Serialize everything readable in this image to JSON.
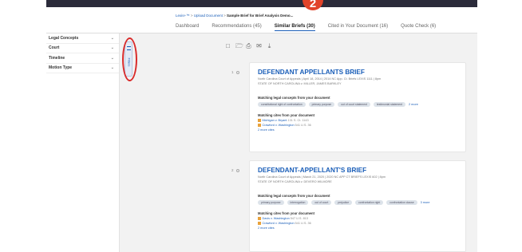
{
  "header": {
    "breadcrumb": [
      "Lexis+™",
      "Upload Document",
      "Sample Brief for Brief Analysis Demo..."
    ],
    "tabs": [
      {
        "label": "Dashboard"
      },
      {
        "label": "Recommendations (45)"
      },
      {
        "label": "Similar Briefs (30)"
      },
      {
        "label": "Cited in Your Document (16)"
      },
      {
        "label": "Quote Check (6)"
      }
    ],
    "active_tab": "Similar Briefs (30)"
  },
  "annotation": {
    "badge_number": "2",
    "color": "#e14329",
    "circle_color": "#d92b2b"
  },
  "sidebar": {
    "facets": [
      {
        "label": "Legal Concepts"
      },
      {
        "label": "Court"
      },
      {
        "label": "Timeline"
      },
      {
        "label": "Motion Type"
      }
    ],
    "collapse_tab_label": "Filters"
  },
  "toolbar": {
    "icons": [
      "checkbox-icon",
      "folder-icon",
      "print-icon",
      "email-icon",
      "download-icon"
    ]
  },
  "results": [
    {
      "number": "1",
      "title": "DEFENDANT APPELLANTS BRIEF",
      "meta": "North Carolina Court of Appeals  |  April 18, 2014  |  2014 NC App. Ct. Briefs LEXIS 1111  |  8pm",
      "parties": "STATE OF NORTH CAROLINA v. MILLER, JAMES BARKLEY",
      "concepts_heading": "Matching legal concepts from your document",
      "concepts": [
        "constitutional right of confrontation",
        "primary purpose",
        "out of court statement",
        "testimonial statement"
      ],
      "concepts_more": "2 more",
      "cites_heading": "Matching cites from your document",
      "cites": [
        {
          "name": "Michigan v. Bryant",
          "cit": "131 S. Ct. 1143",
          "flag": "#e9a23b"
        },
        {
          "name": "Crawford v. Washington",
          "cit": "541 U.S. 36",
          "flag": "#e9a23b"
        }
      ],
      "cites_more": "2 more cites"
    },
    {
      "number": "2",
      "title": "DEFENDANT-APPELLANT'S BRIEF",
      "meta": "North Carolina Court of Appeals  |  March 21, 2020  |  2020 NC APP CT BRIEFS LEXIS 602  |  8pm",
      "parties": "STATE OF NORTH CAROLINA v. DEVERO WILMORE",
      "concepts_heading": "Matching legal concepts from your document",
      "concepts": [
        "primary purpose",
        "interrogation",
        "out of court",
        "prejudice",
        "confrontation right",
        "confrontation clause"
      ],
      "concepts_more": "3 more",
      "cites_heading": "Matching cites from your document",
      "cites": [
        {
          "name": "Davis v. Washington",
          "cit": "547 U.S. 813",
          "flag": "#e9a23b"
        },
        {
          "name": "Crawford v. Washington",
          "cit": "541 U.S. 36",
          "flag": "#e9a23b"
        }
      ],
      "cites_more": "2 more cites"
    }
  ],
  "colors": {
    "link": "#1a5eb8",
    "topbar": "#2b2b3a",
    "chip_bg": "#dde3ea"
  }
}
